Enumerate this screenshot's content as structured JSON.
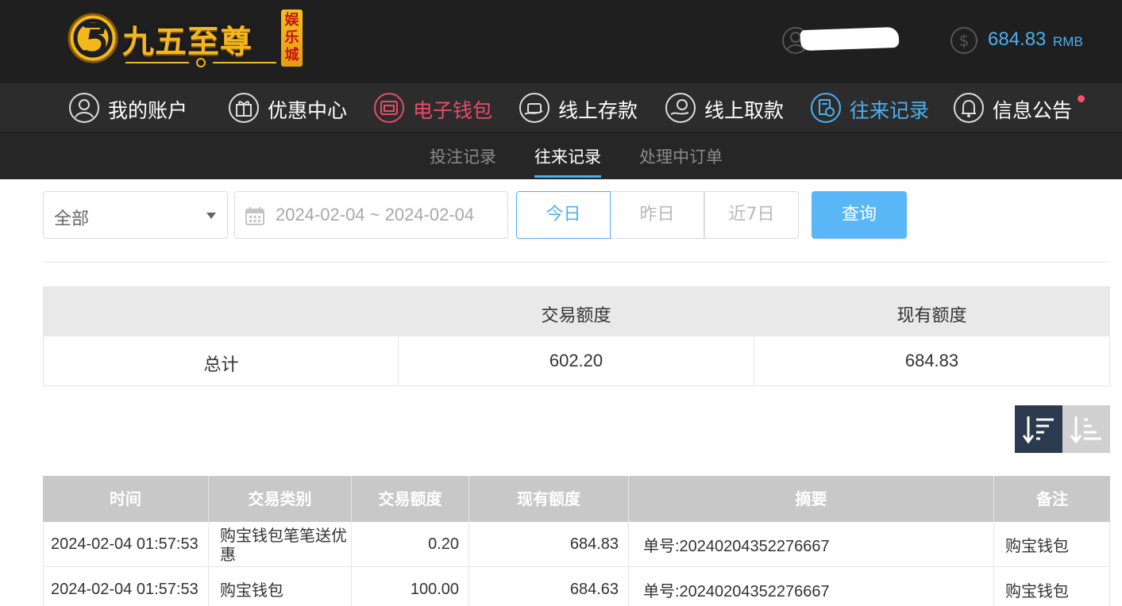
{
  "brand": {
    "logo_text": "九五至尊",
    "badge_text": "娱乐城"
  },
  "account": {
    "username_masked": "",
    "balance": "684.83",
    "currency": "RMB"
  },
  "main_nav": [
    {
      "label": "我的账户",
      "icon": "user-icon",
      "state": "normal"
    },
    {
      "label": "优惠中心",
      "icon": "gift-icon",
      "state": "normal"
    },
    {
      "label": "电子钱包",
      "icon": "wallet-icon",
      "state": "highlight"
    },
    {
      "label": "线上存款",
      "icon": "deposit-icon",
      "state": "normal"
    },
    {
      "label": "线上取款",
      "icon": "withdraw-icon",
      "state": "normal"
    },
    {
      "label": "往来记录",
      "icon": "records-icon",
      "state": "active"
    },
    {
      "label": "信息公告",
      "icon": "bell-icon",
      "state": "normal"
    }
  ],
  "sub_nav": [
    {
      "label": "投注记录",
      "active": false
    },
    {
      "label": "往来记录",
      "active": true
    },
    {
      "label": "处理中订单",
      "active": false
    }
  ],
  "filters": {
    "type_selected": "全部",
    "date_range": "2024-02-04 ~ 2024-02-04",
    "quick_ranges": [
      "今日",
      "昨日",
      "近7日"
    ],
    "quick_selected": "今日",
    "search_label": "查询"
  },
  "summary": {
    "headers": [
      "",
      "交易额度",
      "现有额度"
    ],
    "row_label": "总计",
    "total_amount": "602.20",
    "current_balance": "684.83"
  },
  "sort": {
    "selected": "descending"
  },
  "records": {
    "columns": [
      "时间",
      "交易类别",
      "交易额度",
      "现有额度",
      "摘要",
      "备注"
    ],
    "rows": [
      {
        "time": "2024-02-04 01:57:53",
        "type": "购宝钱包笔笔送优惠",
        "amount": "0.20",
        "balance": "684.83",
        "memo": "单号:20240204352276667",
        "note": "购宝钱包"
      },
      {
        "time": "2024-02-04 01:57:53",
        "type": "购宝钱包",
        "amount": "100.00",
        "balance": "684.63",
        "memo": "单号:20240204352276667",
        "note": "购宝钱包"
      }
    ]
  },
  "colors": {
    "accent_blue": "#4db0f2",
    "highlight_red": "#e84b6a",
    "header_bg": "#1f1f1f",
    "search_button": "#5ab7f7"
  }
}
